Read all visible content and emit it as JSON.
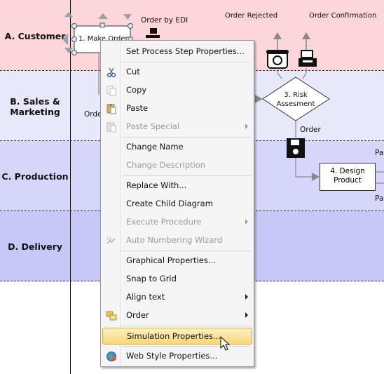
{
  "lanes": [
    {
      "label": "A. Customer"
    },
    {
      "label": "B. Sales &\nMarketing"
    },
    {
      "label": "C. Production"
    },
    {
      "label": "D. Delivery"
    }
  ],
  "diagram": {
    "make_order": "1. Make Order",
    "order_by_edi": "Order by EDI",
    "order_rejected": "Order Rejected",
    "order_confirmation": "Order Confirmation",
    "risk": "3. Risk Assesment",
    "order_label": "Order",
    "orde_partial": "Orde",
    "design_product": "4. Design Product",
    "pa_top": "Pa",
    "pa_bottom": "Pa"
  },
  "menu": {
    "set_props": "Set Process Step Properties...",
    "cut": "Cut",
    "copy": "Copy",
    "paste": "Paste",
    "paste_special": "Paste Special",
    "change_name": "Change Name",
    "change_description": "Change Description",
    "replace_with": "Replace With...",
    "create_child": "Create Child Diagram",
    "execute_procedure": "Execute Procedure",
    "auto_numbering": "Auto Numbering Wizard",
    "graphical_props": "Graphical Properties...",
    "snap_to_grid": "Snap to Grid",
    "align_text": "Align text",
    "order": "Order",
    "simulation_props": "Simulation Properties...",
    "web_style_props": "Web Style Properties..."
  },
  "colors": {
    "lane_a": "#fdd6da",
    "lane_b": "#e8e8fb",
    "lane_c": "#d6d6fb",
    "lane_d": "#c7c7f8",
    "menu_highlight": "#f8d77a"
  }
}
